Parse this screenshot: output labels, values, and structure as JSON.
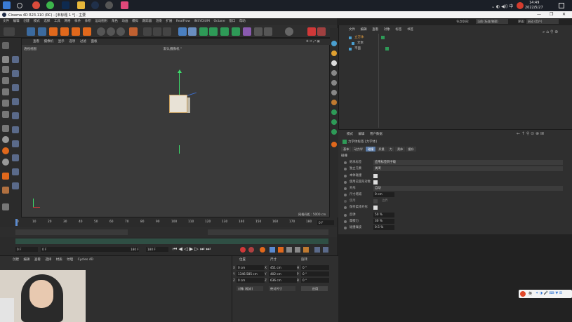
{
  "taskbar": {
    "time": "14:49",
    "date": "2022/5/27"
  },
  "window": {
    "title": "Cinema 4D R23.110 (RC) - [未标题 1 *] - 主要",
    "min": "—",
    "max": "❐",
    "close": "✕"
  },
  "menubar": {
    "items": [
      "文件",
      "编辑",
      "创建",
      "模式",
      "选择",
      "工具",
      "网格",
      "样条",
      "体积",
      "运动图形",
      "角色",
      "动画",
      "模拟",
      "跟踪器",
      "渲染",
      "扩展",
      "RealFlow",
      "INSYDIUM",
      "Octane",
      "窗口",
      "帮助"
    ]
  },
  "viewport": {
    "menu": [
      "查看",
      "摄像机",
      "显示",
      "选项",
      "过滤",
      "面板"
    ],
    "label": "透视视图",
    "camera": "默认摄像机 °",
    "grid_info": "网格间距 : 5000 cm"
  },
  "object_manager": {
    "menu": [
      "文件",
      "编辑",
      "查看",
      "对象",
      "标签",
      "书签"
    ],
    "layout_label": "界面:",
    "layout_value": "启动 (用户)",
    "node_label": "节点空间:",
    "node_value": "当前 (标准/物理)",
    "objects": [
      {
        "name": "立方体"
      },
      {
        "name": "文本"
      },
      {
        "name": "平面"
      }
    ]
  },
  "attribute_manager": {
    "menu": [
      "模式",
      "编辑",
      "用户数据"
    ],
    "object_title": "力学体标签 [力学体]",
    "tabs": [
      "基本",
      "动力学",
      "碰撞",
      "质量",
      "力",
      "柔体",
      "缓存"
    ],
    "active_tab": "碰撞",
    "section": "碰撞",
    "rows": [
      {
        "label": "继承标签",
        "value": "应用标签到子级",
        "type": "select"
      },
      {
        "label": "独立元素",
        "value": "关闭",
        "type": "select"
      },
      {
        "label": "本体碰撞",
        "value": "",
        "type": "check"
      },
      {
        "label": "使用已变形对象",
        "value": "",
        "type": "check"
      },
      {
        "label": "外形",
        "value": "自动",
        "type": "select"
      },
      {
        "label": "尺寸增减",
        "value": "0 cm",
        "type": "field"
      },
      {
        "label": "使用",
        "value": "边界",
        "type": "check"
      },
      {
        "label": "保持柔体外形",
        "value": "",
        "type": "check"
      },
      {
        "label": "反弹",
        "value": "50 %",
        "type": "field"
      },
      {
        "label": "摩擦力",
        "value": "30 %",
        "type": "field"
      },
      {
        "label": "碰撞噪波",
        "value": "0.5 %",
        "type": "field"
      }
    ]
  },
  "timeline": {
    "ticks": [
      "0",
      "10",
      "20",
      "30",
      "40",
      "50",
      "60",
      "70",
      "80",
      "90",
      "100",
      "110",
      "120",
      "130",
      "140",
      "150",
      "160",
      "170",
      "180"
    ],
    "current_frame": "0 F",
    "start": "0 F",
    "start2": "0 F",
    "end": "180 F",
    "end2": "180 F"
  },
  "material_panel": {
    "menu": [
      "创建",
      "编辑",
      "查看",
      "选择",
      "材质",
      "纹理",
      "Cycles 4D"
    ]
  },
  "coordinates": {
    "headers": [
      "位置",
      "尺寸",
      "旋转"
    ],
    "rows": [
      {
        "axis": "X",
        "pos": "0 cm",
        "size": "451 cm",
        "rot_axis": "H",
        "rot": "0 °"
      },
      {
        "axis": "Y",
        "pos": "1346.585 cm",
        "size": "402 cm",
        "rot_axis": "P",
        "rot": "0 °"
      },
      {
        "axis": "Z",
        "pos": "0 cm",
        "size": "636 cm",
        "rot_axis": "B",
        "rot": "0 °"
      }
    ],
    "mode": "对象 (相对)",
    "size_mode": "绝对尺寸",
    "apply": "应用"
  },
  "ime": {
    "lang": "英"
  },
  "colors": {
    "accent_orange": "#e0681c",
    "selection_blue": "#3b6a9e",
    "active_green": "#2e9a57",
    "axis_y": "#3ddc6b",
    "axis_x": "#d03838"
  }
}
